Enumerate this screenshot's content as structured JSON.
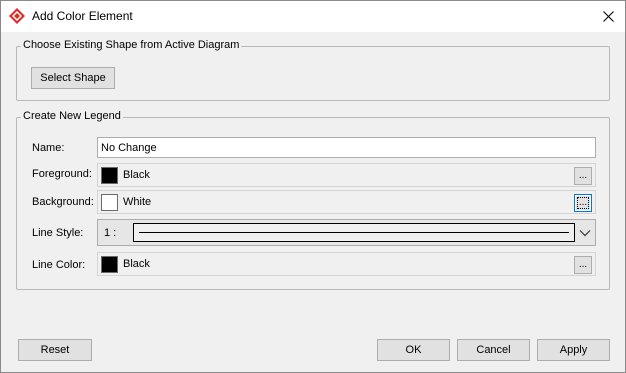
{
  "window": {
    "title": "Add Color Element"
  },
  "existing_shape": {
    "legend": "Choose Existing Shape from Active Diagram",
    "select_button": "Select Shape"
  },
  "new_legend": {
    "legend": "Create New Legend",
    "name": {
      "label": "Name:",
      "value": "No Change"
    },
    "foreground": {
      "label": "Foreground:",
      "color_name": "Black",
      "color": "#000000",
      "button": "..."
    },
    "background": {
      "label": "Background:",
      "color_name": "White",
      "color": "#ffffff",
      "button": "..."
    },
    "line_style": {
      "label": "Line Style:",
      "value": "1 :"
    },
    "line_color": {
      "label": "Line Color:",
      "color_name": "Black",
      "color": "#000000",
      "button": "..."
    }
  },
  "footer": {
    "reset": "Reset",
    "ok": "OK",
    "cancel": "Cancel",
    "apply": "Apply"
  },
  "icons": {
    "app": "visual-paradigm-logo-icon",
    "close": "close-icon",
    "dropdown": "chevron-down-icon"
  },
  "colors": {
    "brand": "#d9302c",
    "focus": "#0078d7"
  }
}
